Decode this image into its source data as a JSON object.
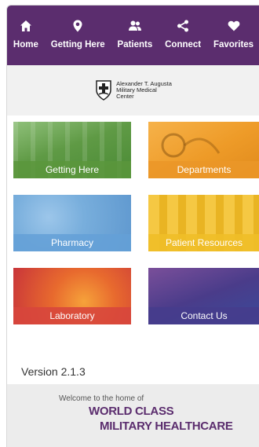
{
  "nav": {
    "items": [
      {
        "label": "Home",
        "icon": "home-icon"
      },
      {
        "label": "Getting Here",
        "icon": "location-pin-icon"
      },
      {
        "label": "Patients",
        "icon": "people-icon"
      },
      {
        "label": "Connect",
        "icon": "share-icon"
      },
      {
        "label": "Favorites",
        "icon": "heart-icon"
      }
    ],
    "color": "#5b2d6e"
  },
  "logo": {
    "line1": "Alexander T. Augusta",
    "line2": "Military Medical",
    "line3": "Center"
  },
  "tiles": [
    {
      "label": "Getting Here",
      "color": "#6aa84f"
    },
    {
      "label": "Departments",
      "color": "#f0a030"
    },
    {
      "label": "Pharmacy",
      "color": "#6fa8dc"
    },
    {
      "label": "Patient Resources",
      "color": "#f2c12e"
    },
    {
      "label": "Laboratory",
      "color": "#e0533a"
    },
    {
      "label": "Contact Us",
      "color": "#4b3e8c"
    }
  ],
  "version": "Version 2.1.3",
  "footer": {
    "welcome": "Welcome to the home of",
    "line1": "WORLD CLASS",
    "line2": "MILITARY HEALTHCARE"
  }
}
